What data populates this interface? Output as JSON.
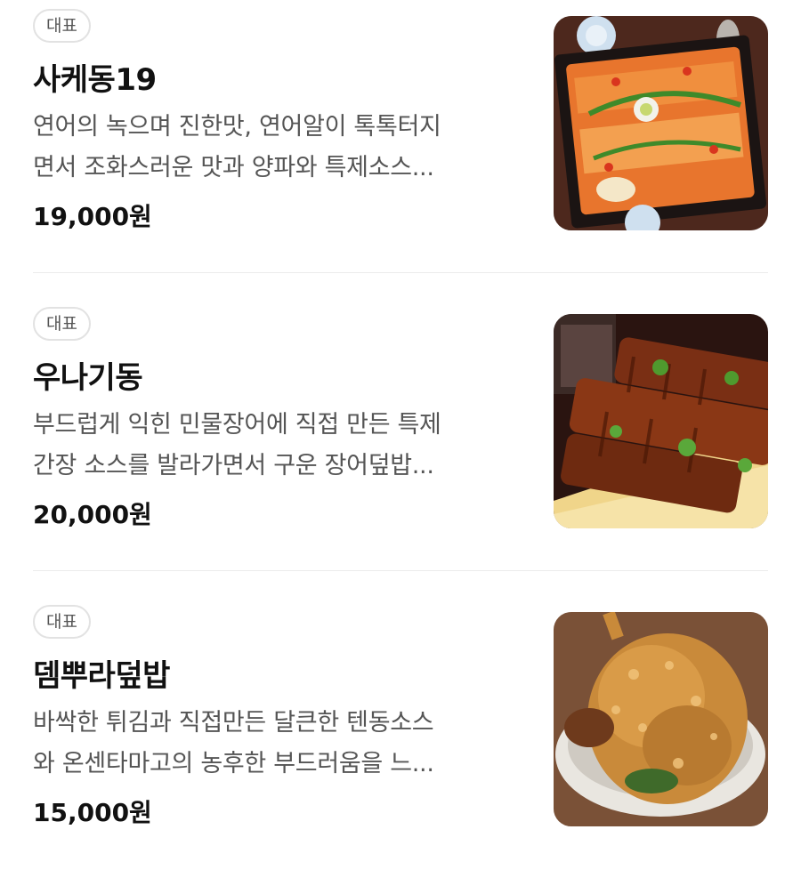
{
  "menu": {
    "items": [
      {
        "badge": "대표",
        "name": "사케동19",
        "desc_line1": "연어의 녹으며 진한맛, 연어알이 톡톡터지",
        "desc_line2": "면서 조화스러운 맛과 양파와 특제소스...",
        "price": "19,000원",
        "image": "salmon-rice-bowl-photo"
      },
      {
        "badge": "대표",
        "name": "우나기동",
        "desc_line1": "부드럽게 익힌 민물장어에 직접 만든 특제",
        "desc_line2": "간장 소스를 발라가면서 구운 장어덮밥...",
        "price": "20,000원",
        "image": "eel-rice-bowl-photo"
      },
      {
        "badge": "대표",
        "name": "뎀뿌라덮밥",
        "desc_line1": "바싹한 튀김과 직접만든 달큰한 텐동소스",
        "desc_line2": "와 온센타마고의 농후한 부드러움을 느...",
        "price": "15,000원",
        "image": "tempura-rice-bowl-photo"
      }
    ]
  }
}
